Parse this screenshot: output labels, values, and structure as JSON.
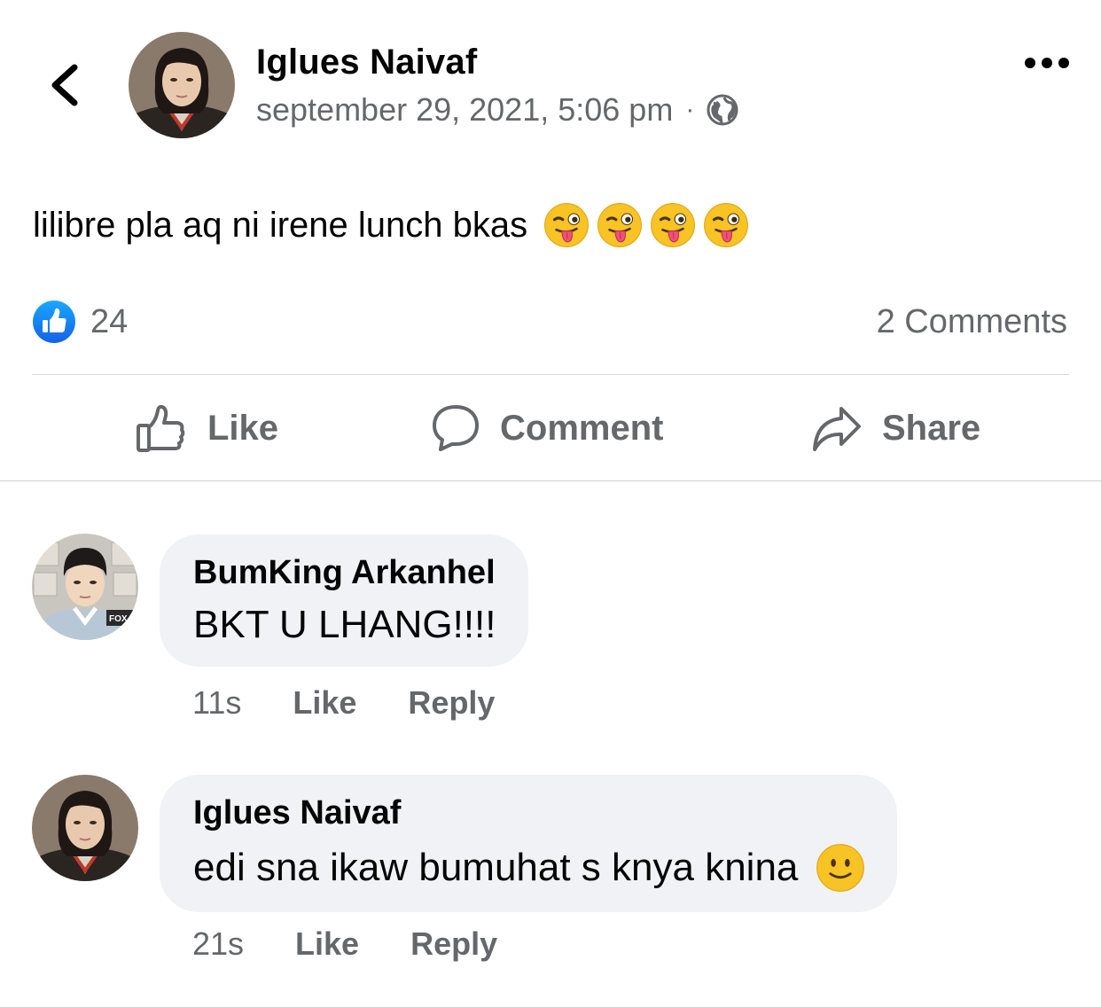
{
  "post": {
    "author": "Iglues Naivaf",
    "timestamp": "september 29, 2021, 5:06 pm",
    "separator": "·",
    "privacy_icon": "globe-icon",
    "text": "lilibre pla aq ni irene lunch bkas",
    "emojis": [
      "winking-face-with-tongue",
      "winking-face-with-tongue",
      "winking-face-with-tongue",
      "winking-face-with-tongue"
    ],
    "reaction_count": "24",
    "comment_count": "2 Comments"
  },
  "actions": {
    "like": "Like",
    "comment": "Comment",
    "share": "Share"
  },
  "comments": [
    {
      "author": "BumKing Arkanhel",
      "text": "BKT U LHANG!!!!",
      "time": "11s",
      "like": "Like",
      "reply": "Reply"
    },
    {
      "author": "Iglues Naivaf",
      "text": "edi sna ikaw bumuhat s knya knina",
      "emoji": "slightly-smiling-face",
      "time": "21s",
      "like": "Like",
      "reply": "Reply"
    }
  ],
  "colors": {
    "like_blue": "#1877f2",
    "secondary_text": "#65676b",
    "bubble_bg": "#f0f2f5"
  }
}
